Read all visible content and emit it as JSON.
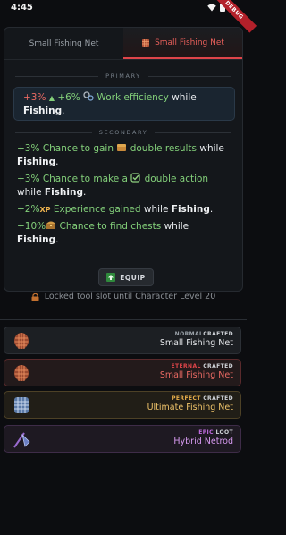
{
  "status": {
    "time": "4:45",
    "debug_label": "DEBUG"
  },
  "tabs": [
    {
      "label": "Small Fishing Net"
    },
    {
      "label": "Small Fishing Net"
    }
  ],
  "primary": {
    "section_label": "PRIMARY",
    "value1": "+3%",
    "arrow": "▲",
    "value2": "+6%",
    "stat": "Work efficiency",
    "while": "while",
    "skill": "Fishing",
    "period": "."
  },
  "secondary": {
    "section_label": "SECONDARY",
    "items": [
      {
        "value": "+3%",
        "text_a": "Chance to gain",
        "highlight": "double results",
        "text_b": "while",
        "skill": "Fishing",
        "period": "."
      },
      {
        "value": "+3%",
        "text_a": "Chance to make a",
        "highlight": "double action",
        "text_b": "while",
        "skill": "Fishing",
        "period": "."
      },
      {
        "value": "+2%",
        "xp": "XP",
        "highlight": "Experience gained",
        "text_b": "while",
        "skill": "Fishing",
        "period": "."
      },
      {
        "value": "+10%",
        "highlight": "Chance to find chests",
        "text_b": "while",
        "skill": "Fishing",
        "period": "."
      }
    ]
  },
  "equip_label": "EQUIP",
  "locked_note": "Locked tool slot until Character Level 20",
  "inventory": [
    {
      "rarity": "NORMAL",
      "source": "CRAFTED",
      "name": "Small Fishing Net",
      "color": "#9aa1a8",
      "name_color": "#e4e6e9",
      "bg": "#1c1f23",
      "border": "#2c3036"
    },
    {
      "rarity": "ETERNAL",
      "source": "CRAFTED",
      "name": "Small Fishing Net",
      "color": "#e0454a",
      "name_color": "#ea6a63",
      "bg": "#231a1b",
      "border": "#5a2a2c"
    },
    {
      "rarity": "PERFECT",
      "source": "CRAFTED",
      "name": "Ultimate Fishing Net",
      "color": "#e9b04b",
      "name_color": "#f0c46a",
      "bg": "#211e17",
      "border": "#4d4126"
    },
    {
      "rarity": "EPIC",
      "source": "LOOT",
      "name": "Hybrid Netrod",
      "color": "#c06be0",
      "name_color": "#d79af0",
      "bg": "#1e1922",
      "border": "#3e2c48"
    }
  ]
}
